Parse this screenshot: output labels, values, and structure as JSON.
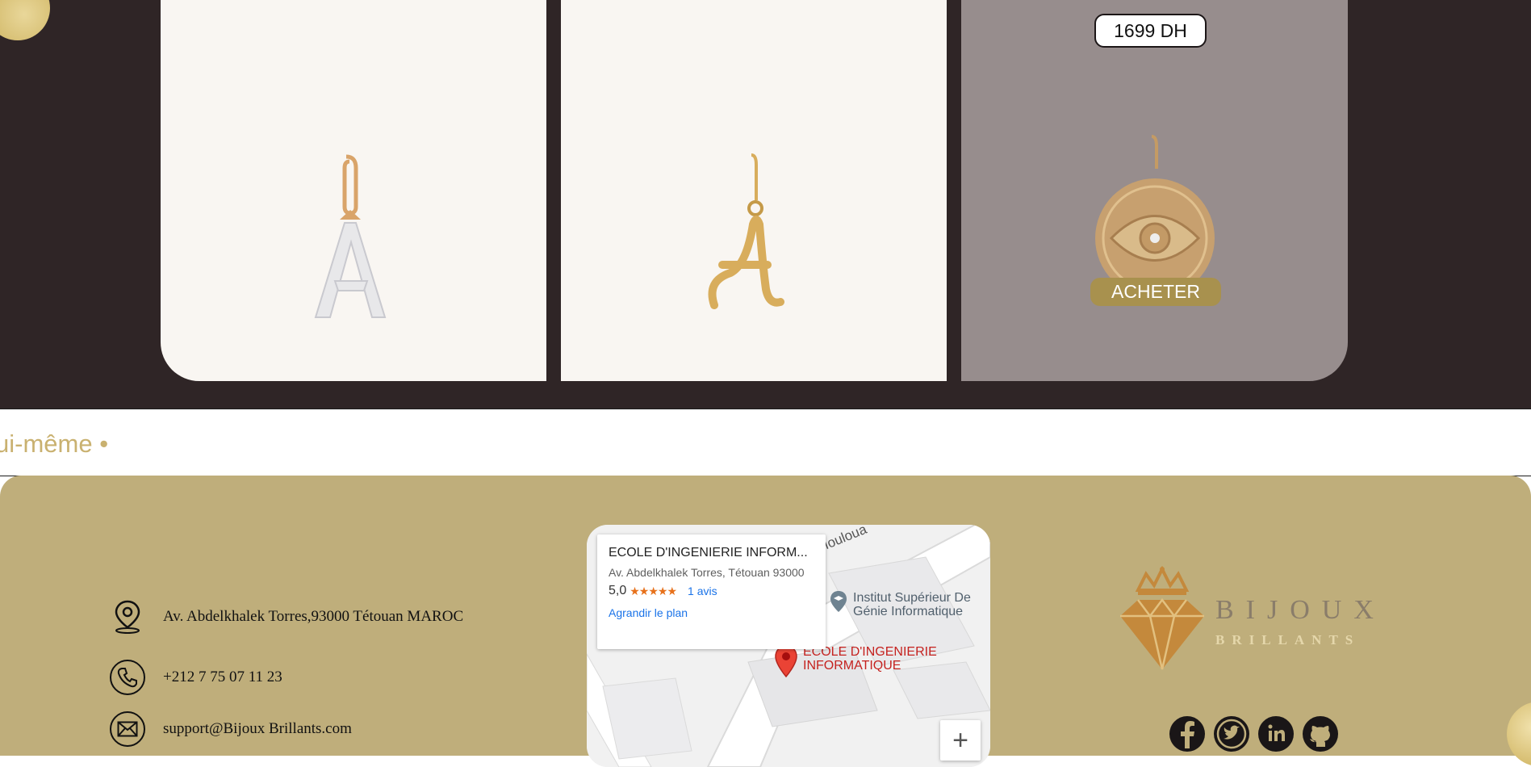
{
  "products": {
    "cards": [
      {
        "name": "Pendentif lettre A pavée de diamants"
      },
      {
        "name": "Pendentif lettre A cursive or"
      },
      {
        "name": "Médaille œil",
        "price": "1699 DH",
        "buy_label": "ACHETER"
      }
    ]
  },
  "marquee": {
    "text": "ui-même •"
  },
  "footer": {
    "contact": {
      "address": "Av. Abdelkhalek Torres,93000 Tétouan MAROC",
      "phone": "+212 7 75 07 11 23",
      "email": "support@Bijoux Brillants.com"
    },
    "map": {
      "place_title": "ECOLE D'INGENIERIE INFORM...",
      "place_address": "Av. Abdelkhalek Torres, Tétouan 93000",
      "rating": "5,0",
      "stars": "★★★★★",
      "reviews": "1 avis",
      "enlarge_link": "Agrandir le plan",
      "street_label": "Houloua",
      "poi_label_1": "Institut Supérieur De",
      "poi_label_2": "Génie Informatique",
      "marker_label_1": "ECOLE D'INGENIERIE",
      "marker_label_2": "INFORMATIQUE",
      "zoom_in": "+"
    },
    "brand": {
      "name": "BIJOUX",
      "sub": "BRILLANTS"
    },
    "socials": [
      "facebook-icon",
      "twitter-icon",
      "linkedin-icon",
      "github-icon"
    ]
  },
  "colors": {
    "dark_bg": "#2f2526",
    "card_bg": "#f9f6f2",
    "gold": "#bfae7b",
    "accent": "#a8914e"
  }
}
